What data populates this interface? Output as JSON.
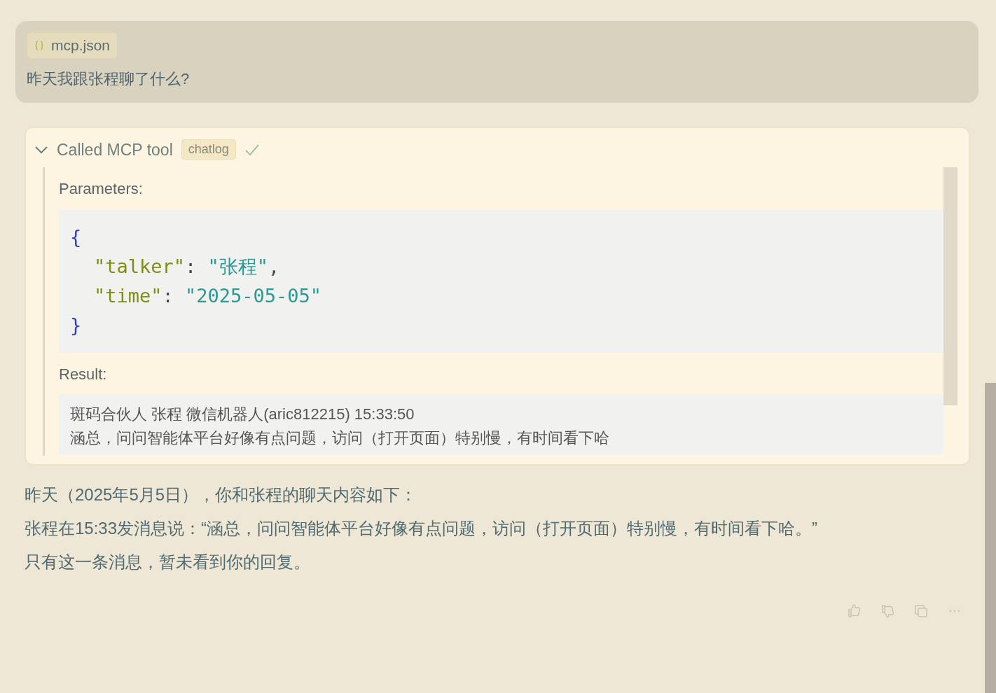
{
  "user_message": {
    "attachment": {
      "label": "mcp.json"
    },
    "text": "昨天我跟张程聊了什么?"
  },
  "tool_call": {
    "title": "Called MCP tool",
    "tool": "chatlog",
    "success": true,
    "expanded": true,
    "parameters_label": "Parameters:",
    "parameters_code": [
      [
        {
          "kind": "brace",
          "text": "{"
        }
      ],
      [
        {
          "kind": "key",
          "text": "\"talker\""
        },
        {
          "kind": "punct",
          "text": ": "
        },
        {
          "kind": "string",
          "text": "\"张程\""
        },
        {
          "kind": "punct",
          "text": ","
        }
      ],
      [
        {
          "kind": "key",
          "text": "\"time\""
        },
        {
          "kind": "punct",
          "text": ": "
        },
        {
          "kind": "string",
          "text": "\"2025-05-05\""
        }
      ],
      [
        {
          "kind": "brace",
          "text": "}"
        }
      ]
    ],
    "result_label": "Result:",
    "result_lines": [
      "斑码合伙人  张程  微信机器人(aric812215) 15:33:50",
      "涵总，问问智能体平台好像有点问题，访问（打开页面）特别慢，有时间看下哈"
    ]
  },
  "answer": [
    "昨天（2025年5月5日），你和张程的聊天内容如下：",
    "张程在15:33发消息说：“涵总，问问智能体平台好像有点问题，访问（打开页面）特别慢，有时间看下哈。”",
    "只有这一条消息，暂未看到你的回复。"
  ]
}
